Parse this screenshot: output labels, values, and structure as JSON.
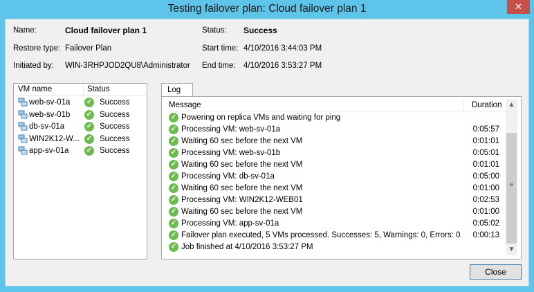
{
  "window": {
    "title": "Testing failover plan: Cloud failover plan 1",
    "close_glyph": "✕"
  },
  "info": {
    "name_label": "Name:",
    "name_value": "Cloud failover plan 1",
    "restore_type_label": "Restore type:",
    "restore_type_value": "Failover Plan",
    "initiated_label": "Initiated by:",
    "initiated_value": "WIN-3RHPJOD2QU8\\Administrator",
    "status_label": "Status:",
    "status_value": "Success",
    "start_label": "Start time:",
    "start_value": "4/10/2016 3:44:03 PM",
    "end_label": "End time:",
    "end_value": "4/10/2016 3:53:27 PM"
  },
  "vm_list": {
    "headers": {
      "name": "VM name",
      "status": "Status"
    },
    "rows": [
      {
        "name": "web-sv-01a",
        "status": "Success"
      },
      {
        "name": "web-sv-01b",
        "status": "Success"
      },
      {
        "name": "db-sv-01a",
        "status": "Success"
      },
      {
        "name": "WIN2K12-W...",
        "status": "Success"
      },
      {
        "name": "app-sv-01a",
        "status": "Success"
      }
    ]
  },
  "log": {
    "tab_label": "Log",
    "headers": {
      "message": "Message",
      "duration": "Duration"
    },
    "rows": [
      {
        "message": "Powering on replica VMs and waiting for ping",
        "duration": ""
      },
      {
        "message": "Processing VM: web-sv-01a",
        "duration": "0:05:57"
      },
      {
        "message": "Waiting 60 sec before the next VM",
        "duration": "0:01:01"
      },
      {
        "message": "Processing VM: web-sv-01b",
        "duration": "0:05:01"
      },
      {
        "message": "Waiting 60 sec before the next VM",
        "duration": "0:01:01"
      },
      {
        "message": "Processing VM: db-sv-01a",
        "duration": "0:05:00"
      },
      {
        "message": "Waiting 60 sec before the next VM",
        "duration": "0:01:00"
      },
      {
        "message": "Processing VM: WIN2K12-WEB01",
        "duration": "0:02:53"
      },
      {
        "message": "Waiting 60 sec before the next VM",
        "duration": "0:01:00"
      },
      {
        "message": "Processing VM: app-sv-01a",
        "duration": "0:05:02"
      },
      {
        "message": "Failover plan executed, 5 VMs processed. Successes: 5, Warnings: 0, Errors: 0.",
        "duration": "0:00:13"
      },
      {
        "message": "Job finished at 4/10/2016 3:53:27 PM",
        "duration": ""
      }
    ]
  },
  "buttons": {
    "close_label": "Close"
  },
  "icons": {
    "success": "check-circle-icon",
    "vm": "vm-icon"
  },
  "colors": {
    "title_bar": "#5fc4ea",
    "success": "#6dbb4e",
    "close_x": "#c7504b"
  }
}
